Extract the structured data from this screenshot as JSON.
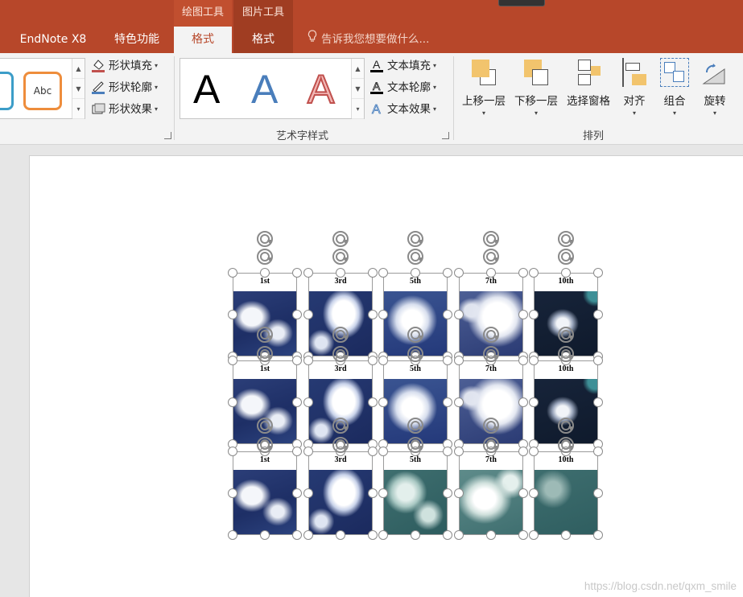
{
  "tabs": {
    "context_draw": "绘图工具",
    "context_picture": "图片工具",
    "endnote": "EndNote X8",
    "special": "特色功能",
    "draw_format": "格式",
    "picture_format": "格式",
    "tell_me": "告诉我您想要做什么..."
  },
  "ribbon": {
    "shape_styles": {
      "sample_label": "Abc",
      "fill": "形状填充",
      "outline": "形状轮廓",
      "effect": "形状效果"
    },
    "wordart": {
      "group_label": "艺术字样式",
      "sample_glyph": "A",
      "text_fill": "文本填充",
      "text_outline": "文本轮廓",
      "text_effect": "文本效果"
    },
    "arrange": {
      "group_label": "排列",
      "bring_forward": "上移一层",
      "send_backward": "下移一层",
      "selection_pane": "选择窗格",
      "align": "对齐",
      "group": "组合",
      "rotate": "旋转"
    }
  },
  "slide": {
    "rows": [
      {
        "labels": [
          "1st",
          "3rd",
          "5th",
          "7th",
          "10th"
        ]
      },
      {
        "labels": [
          "1st",
          "3rd",
          "5th",
          "7th",
          "10th"
        ]
      },
      {
        "labels": [
          "1st",
          "3rd",
          "5th",
          "7th",
          "10th"
        ]
      }
    ]
  },
  "watermark": "https://blog.csdn.net/qxm_smile",
  "colors": {
    "accent": "#b7472a",
    "ribbon_bg": "#f3f3f3",
    "workspace_bg": "#e6e6e6"
  },
  "icons": {
    "tell_me": "lightbulb-icon",
    "rotate_handle": "rotate-handle-icon"
  }
}
